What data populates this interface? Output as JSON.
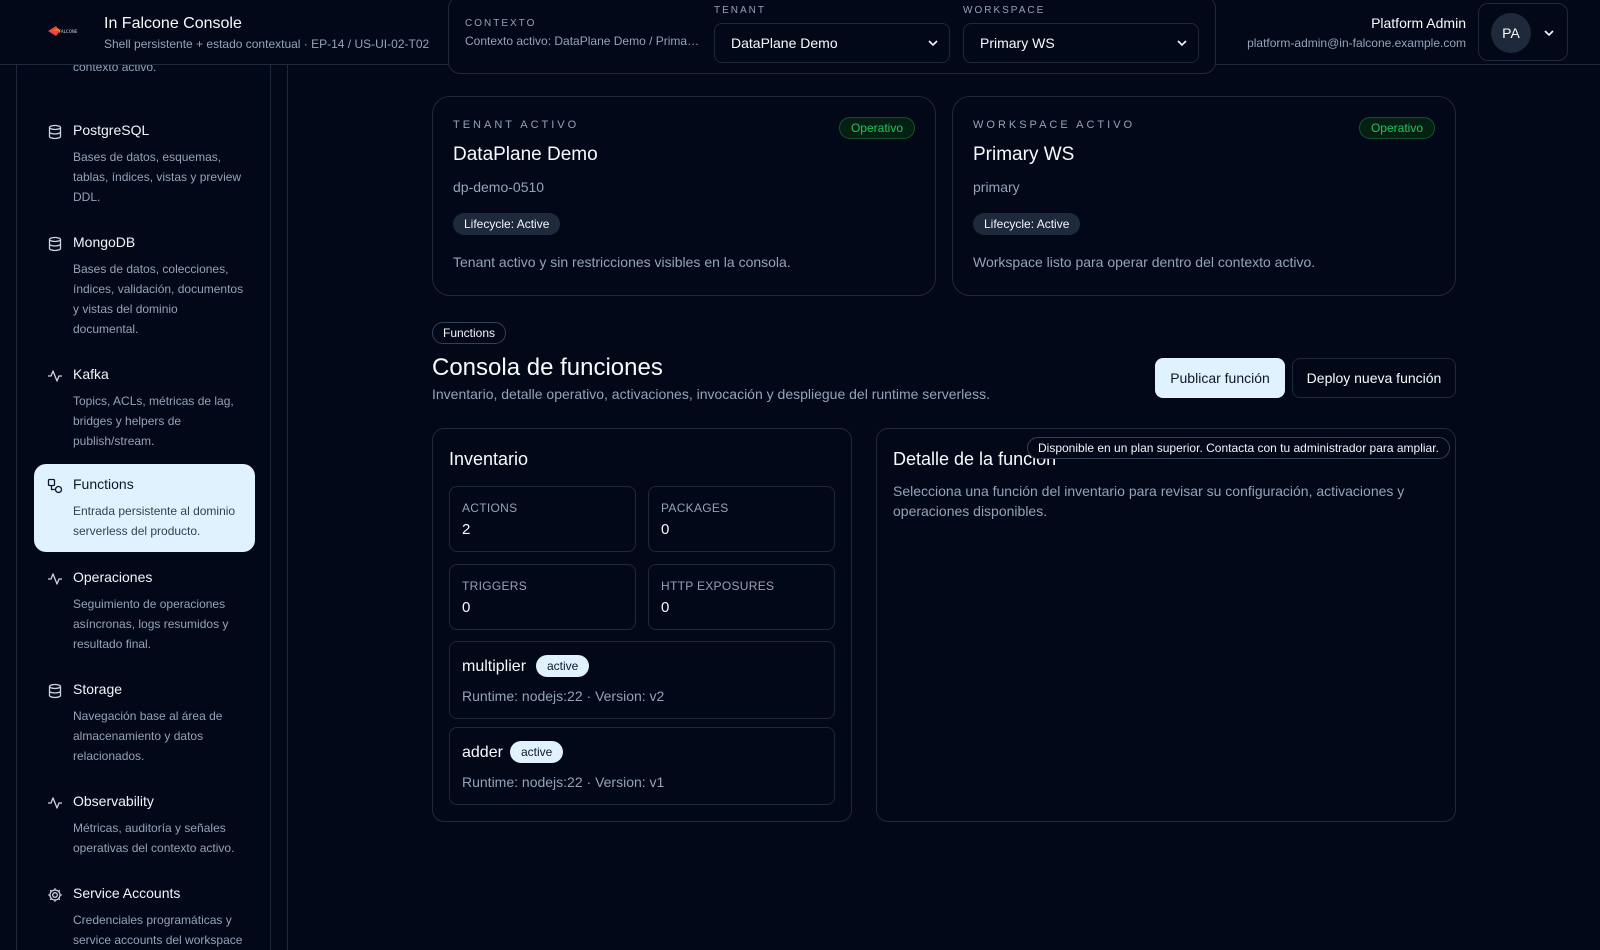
{
  "header": {
    "app_title": "In Falcone Console",
    "app_subtitle": "Shell persistente + estado contextual · EP-14 / US-UI-02-T02",
    "context_label": "CONTEXTO",
    "context_value": "Contexto activo: DataPlane Demo / Primary WS",
    "tenant_label": "TENANT",
    "tenant_selected": "DataPlane Demo",
    "workspace_label": "WORKSPACE",
    "workspace_selected": "Primary WS",
    "user_name": "Platform Admin",
    "user_email": "platform-admin@in-falcone.example.com",
    "user_initials": "PA"
  },
  "sidebar": {
    "items": [
      {
        "label": "",
        "desc": "contexto activo.",
        "icon": "partial"
      },
      {
        "label": "PostgreSQL",
        "desc": "Bases de datos, esquemas, tablas, índices, vistas y preview DDL.",
        "icon": "database-icon"
      },
      {
        "label": "MongoDB",
        "desc": "Bases de datos, colecciones, índices, validación, documentos y vistas del dominio documental.",
        "icon": "database-icon"
      },
      {
        "label": "Kafka",
        "desc": "Topics, ACLs, métricas de lag, bridges y helpers de publish/stream.",
        "icon": "activity-icon"
      },
      {
        "label": "Functions",
        "desc": "Entrada persistente al dominio serverless del producto.",
        "icon": "functions-icon",
        "active": true
      },
      {
        "label": "Operaciones",
        "desc": "Seguimiento de operaciones asíncronas, logs resumidos y resultado final.",
        "icon": "activity-icon"
      },
      {
        "label": "Storage",
        "desc": "Navegación base al área de almacenamiento y datos relacionados.",
        "icon": "database-icon"
      },
      {
        "label": "Observability",
        "desc": "Métricas, auditoría y señales operativas del contexto activo.",
        "icon": "activity-icon"
      },
      {
        "label": "Service Accounts",
        "desc": "Credenciales programáticas y service accounts del workspace",
        "icon": "gear-icon"
      }
    ]
  },
  "tenant_card": {
    "eyebrow": "TENANT ACTIVO",
    "title": "DataPlane Demo",
    "slug": "dp-demo-0510",
    "lifecycle": "Lifecycle: Active",
    "status": "Operativo",
    "desc": "Tenant activo y sin restricciones visibles en la consola."
  },
  "workspace_card": {
    "eyebrow": "WORKSPACE ACTIVO",
    "title": "Primary WS",
    "slug": "primary",
    "lifecycle": "Lifecycle: Active",
    "status": "Operativo",
    "desc": "Workspace listo para operar dentro del contexto activo."
  },
  "section": {
    "tag": "Functions",
    "title": "Consola de funciones",
    "subtitle": "Inventario, detalle operativo, activaciones, invocación y despliegue del runtime serverless.",
    "primary_button": "Publicar función",
    "secondary_button": "Deploy nueva función"
  },
  "inventory": {
    "title": "Inventario",
    "stats": [
      {
        "label": "ACTIONS",
        "value": "2"
      },
      {
        "label": "PACKAGES",
        "value": "0"
      },
      {
        "label": "TRIGGERS",
        "value": "0"
      },
      {
        "label": "HTTP EXPOSURES",
        "value": "0"
      }
    ],
    "functions": [
      {
        "name": "multiplier",
        "status": "active",
        "meta": "Runtime: nodejs:22 · Version: v2"
      },
      {
        "name": "adder",
        "status": "active",
        "meta": "Runtime: nodejs:22 · Version: v1"
      }
    ]
  },
  "detail": {
    "title": "Detalle de la función",
    "desc": "Selecciona una función del inventario para revisar su configuración, activaciones y operaciones disponibles.",
    "tooltip": "Disponible en un plan superior. Contacta con tu administrador para ampliar."
  },
  "colors": {
    "background": "#020817",
    "border": "#1e293b",
    "accent": "#e0f2fe",
    "status_ok": "#22c55e"
  }
}
